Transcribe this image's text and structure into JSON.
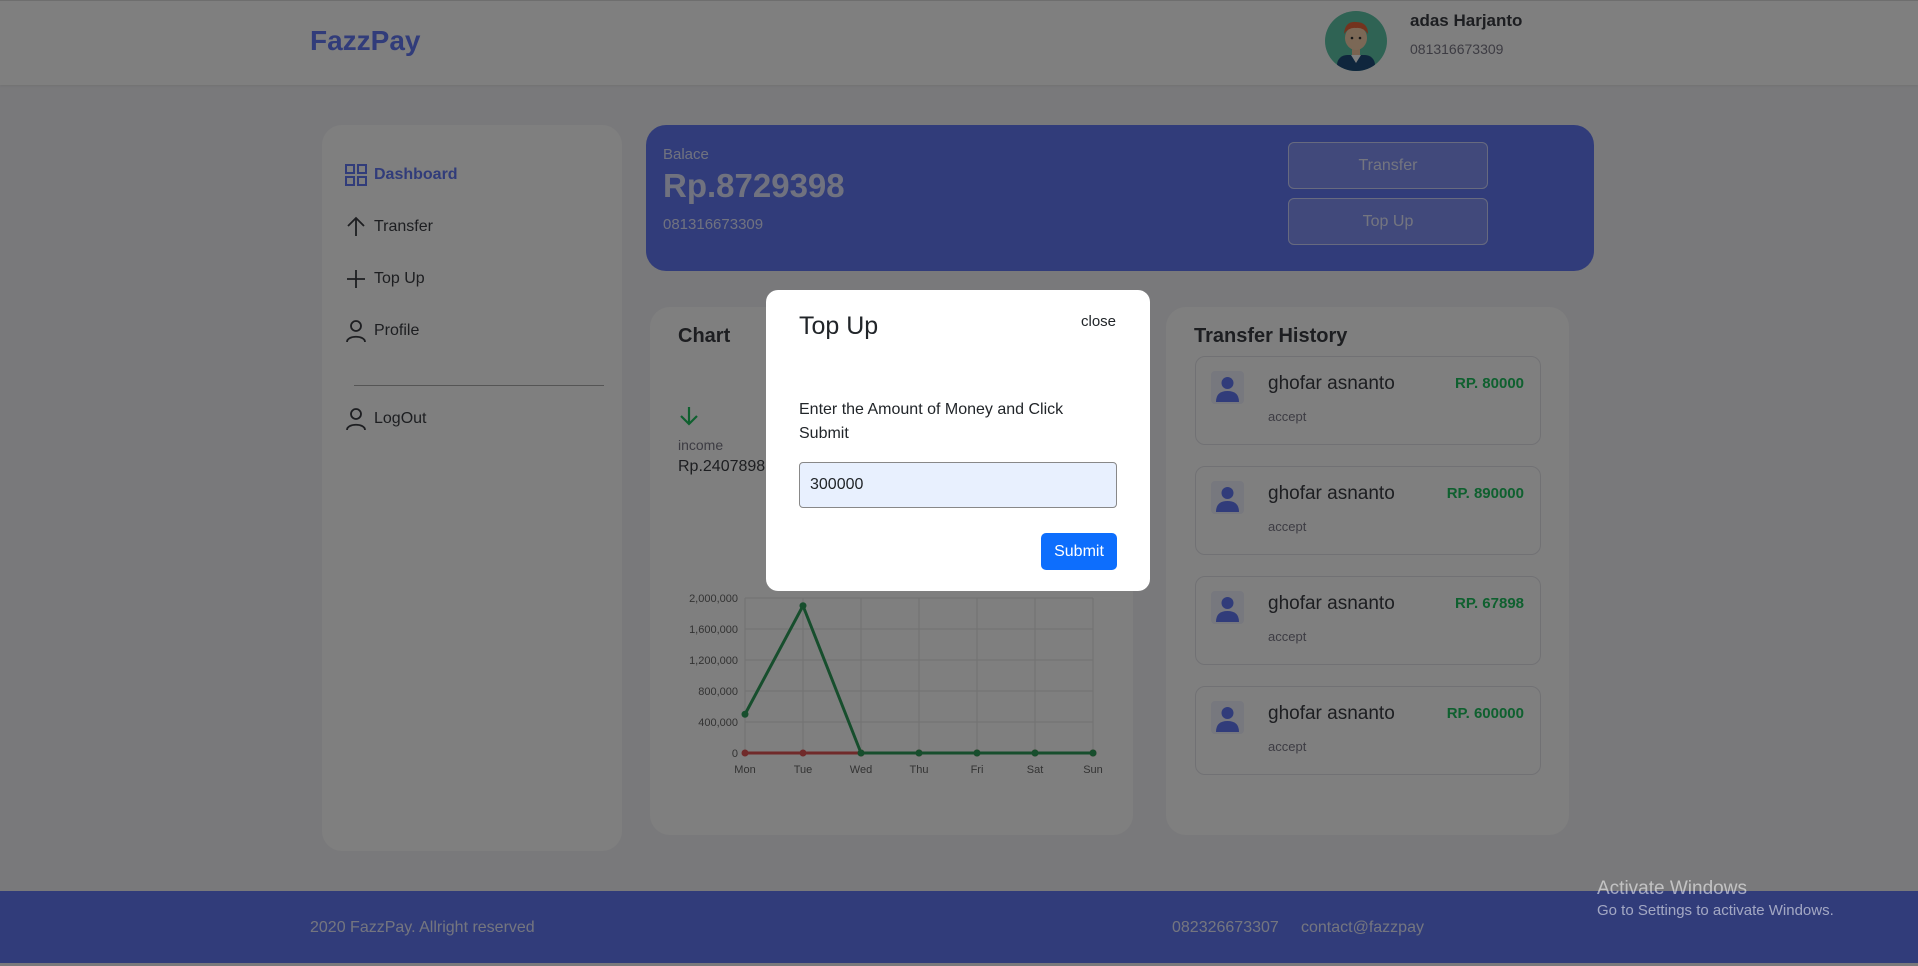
{
  "header": {
    "brand": "FazzPay",
    "user_name": "adas Harjanto",
    "user_phone": "081316673309"
  },
  "sidebar": {
    "items": [
      {
        "label": "Dashboard",
        "icon": "grid-icon"
      },
      {
        "label": "Transfer",
        "icon": "arrow-up-icon"
      },
      {
        "label": "Top Up",
        "icon": "plus-icon"
      },
      {
        "label": "Profile",
        "icon": "user-icon"
      }
    ],
    "logout": "LogOut"
  },
  "balance": {
    "label": "Balace",
    "value": "Rp.8729398",
    "phone": "081316673309",
    "transfer_label": "Transfer",
    "topup_label": "Top Up"
  },
  "chart_card": {
    "title": "Chart",
    "income_label": "income",
    "income_value": "Rp.2407898"
  },
  "chart_data": {
    "type": "line",
    "categories": [
      "Mon",
      "Tue",
      "Wed",
      "Thu",
      "Fri",
      "Sat",
      "Sun"
    ],
    "ylim": [
      0,
      2000000
    ],
    "yticks": [
      "0",
      "400,000",
      "800,000",
      "1,200,000",
      "1,600,000",
      "2,000,000"
    ],
    "grid": true,
    "series": [
      {
        "color": "#2e9d5a",
        "values": [
          500000,
          1900000,
          0,
          0,
          0,
          0,
          0
        ]
      },
      {
        "color": "#e05555",
        "values": [
          0,
          0,
          0,
          0,
          0,
          0,
          0
        ]
      }
    ]
  },
  "history": {
    "title": "Transfer History",
    "items": [
      {
        "name": "ghofar asnanto",
        "status": "accept",
        "amount": "RP. 80000"
      },
      {
        "name": "ghofar asnanto",
        "status": "accept",
        "amount": "RP. 890000"
      },
      {
        "name": "ghofar asnanto",
        "status": "accept",
        "amount": "RP. 67898"
      },
      {
        "name": "ghofar asnanto",
        "status": "accept",
        "amount": "RP. 600000"
      }
    ]
  },
  "footer": {
    "copyright": "2020 FazzPay. Allright reserved",
    "phone": "082326673307",
    "email": "contact@fazzpay"
  },
  "modal": {
    "title": "Top Up",
    "close_label": "close",
    "description": "Enter the Amount of Money and Click Submit",
    "input_value": "300000",
    "submit_label": "Submit"
  },
  "watermark": {
    "line1": "Activate Windows",
    "line2": "Go to Settings to activate Windows."
  },
  "colors": {
    "primary": "#6379f4",
    "income_green": "#1ec15f",
    "submit_blue": "#0d6efd"
  }
}
